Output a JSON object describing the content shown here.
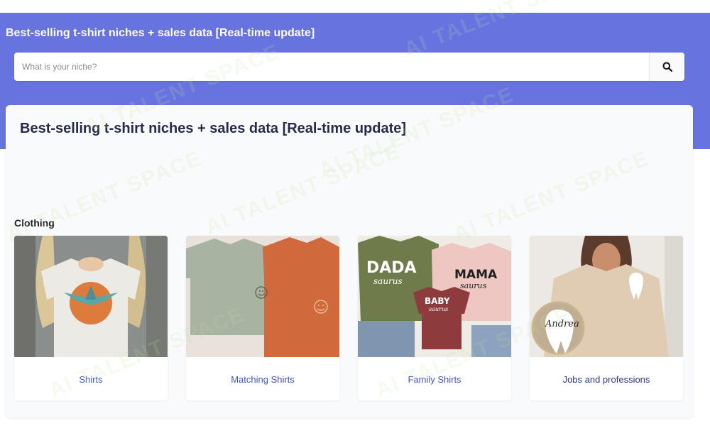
{
  "header": {
    "title": "Best-selling t-shirt niches + sales data [Real-time update]"
  },
  "search": {
    "placeholder": "What is your niche?",
    "button_icon": "search-icon"
  },
  "page": {
    "title": "Best-selling t-shirt niches + sales data [Real-time update]"
  },
  "section": {
    "label": "Clothing"
  },
  "cards": [
    {
      "label": "Shirts"
    },
    {
      "label": "Matching Shirts"
    },
    {
      "label": "Family Shirts"
    },
    {
      "label": "Jobs and professions"
    }
  ],
  "images": {
    "dada_text": "DADA",
    "dada_sub": "saurus",
    "mama_text": "MAMA",
    "mama_sub": "saurus",
    "baby_text": "BABY",
    "baby_sub": "saurus",
    "andrea": "Andrea"
  },
  "watermark": {
    "text": "AI TALENT SPACE"
  },
  "colors": {
    "hero": "#6774e0",
    "link": "#4455c6",
    "title": "#252b4a"
  }
}
